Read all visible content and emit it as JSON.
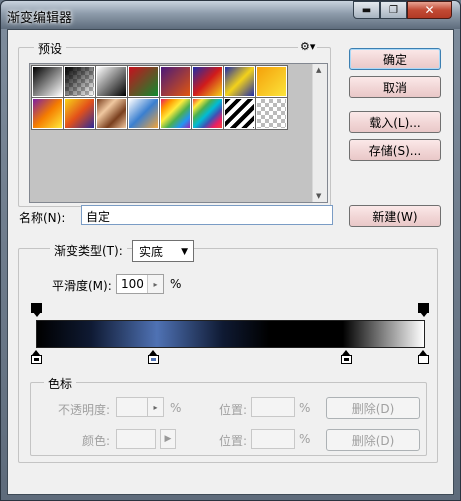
{
  "window": {
    "title": "渐变编辑器",
    "controls": {
      "minimize_icon": "minimize-icon",
      "restore_icon": "restore-icon",
      "close_icon": "close-icon"
    }
  },
  "presets": {
    "label": "预设",
    "menu_icon": "gear-icon",
    "swatch_count": 16
  },
  "buttons": {
    "ok": "确定",
    "cancel": "取消",
    "load": "载入(L)...",
    "save": "存储(S)...",
    "new": "新建(W)"
  },
  "name_field": {
    "label": "名称(N):",
    "value": "自定"
  },
  "gradient_type": {
    "label": "渐变类型(T):",
    "value": "实底"
  },
  "smoothness": {
    "label": "平滑度(M):",
    "value": "100",
    "unit": "%"
  },
  "color_stops": {
    "label": "色标",
    "opacity_label": "不透明度:",
    "opacity_unit": "%",
    "location_label": "位置:",
    "location_unit": "%",
    "delete_label": "删除(D)",
    "color_label": "颜色:"
  },
  "stops_bottom": [
    {
      "color": "#000000",
      "location": 0
    },
    {
      "color": "#4f72b4",
      "location": 31
    },
    {
      "color": "#000000",
      "location": 80
    },
    {
      "color": "#ffffff",
      "location": 100
    }
  ],
  "stops_top": [
    {
      "opacity": 100,
      "location": 0
    },
    {
      "opacity": 100,
      "location": 100
    }
  ]
}
